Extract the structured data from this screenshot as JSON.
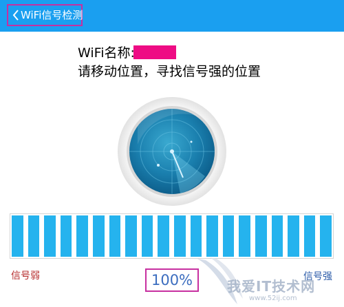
{
  "header": {
    "title": "WiFi信号检测",
    "back_icon": "chevron-left-icon",
    "background_color": "#1a9ff0"
  },
  "wifi": {
    "name_label": "WiFi名称:",
    "instruction": "请移动位置，寻找信号强的位置"
  },
  "signal": {
    "bar_count": 20,
    "filled_fraction": 1.0,
    "bar_color": "#25b3ee",
    "weak_label": "信号弱",
    "strong_label": "信号强",
    "percent": "100%"
  },
  "watermark": {
    "text": "我爱IT技术网",
    "url": "www.52ij.com"
  }
}
